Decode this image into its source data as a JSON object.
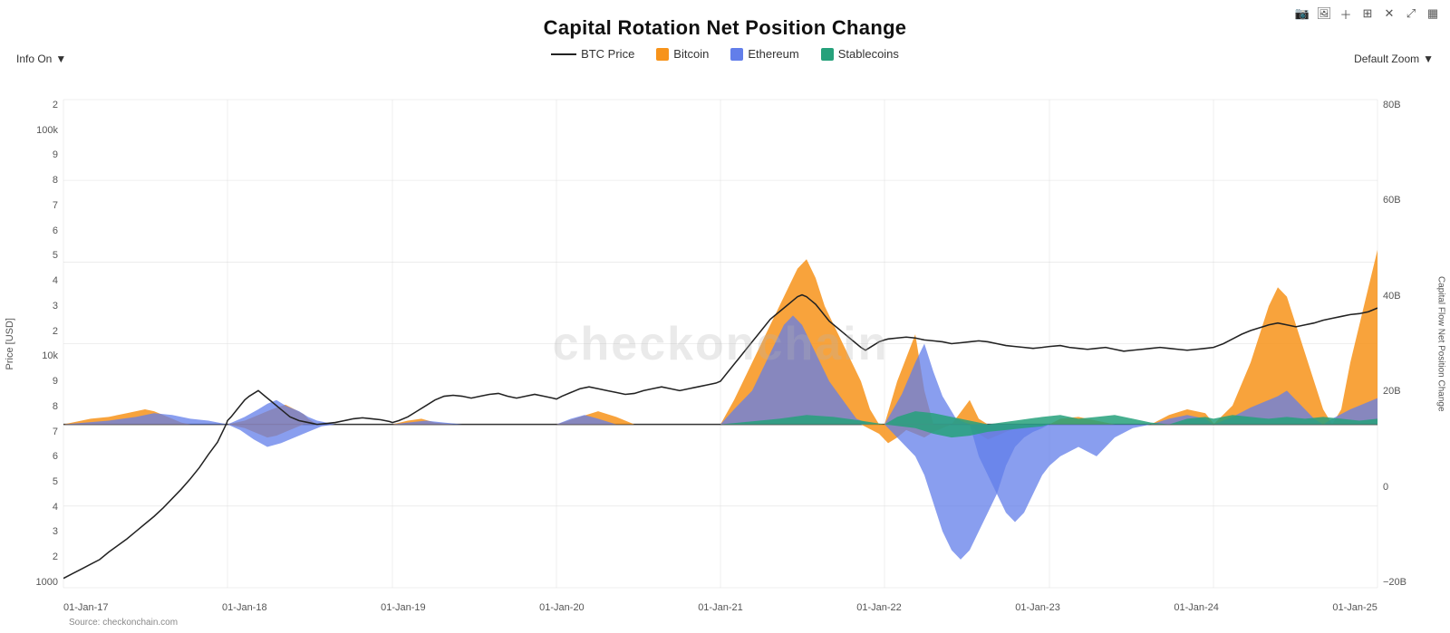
{
  "title": "Capital Rotation Net Position Change",
  "info_dropdown": {
    "label": "Info On",
    "value": "Info On"
  },
  "zoom_dropdown": {
    "label": "Default Zoom",
    "value": "Default Zoom"
  },
  "legend": {
    "items": [
      {
        "id": "btc-price",
        "label": "BTC Price",
        "type": "line",
        "color": "#222222"
      },
      {
        "id": "bitcoin",
        "label": "Bitcoin",
        "type": "area",
        "color": "#F7931A"
      },
      {
        "id": "ethereum",
        "label": "Ethereum",
        "type": "area",
        "color": "#627EEA"
      },
      {
        "id": "stablecoins",
        "label": "Stablecoins",
        "type": "area",
        "color": "#26A17B"
      }
    ]
  },
  "y_axis_left": {
    "label": "Price [USD]",
    "ticks": [
      "100k",
      "9",
      "8",
      "7",
      "6",
      "5",
      "4",
      "3",
      "2",
      "10k",
      "9",
      "8",
      "7",
      "6",
      "5",
      "4",
      "3",
      "2",
      "1000"
    ]
  },
  "y_axis_right": {
    "label": "Capital Flow Net Position Change",
    "ticks": [
      "80B",
      "60B",
      "40B",
      "20B",
      "0",
      "−20B"
    ]
  },
  "x_axis": {
    "ticks": [
      "01-Jan-17",
      "01-Jan-18",
      "01-Jan-19",
      "01-Jan-20",
      "01-Jan-21",
      "01-Jan-22",
      "01-Jan-23",
      "01-Jan-24",
      "01-Jan-25"
    ]
  },
  "watermark": "checkonchain",
  "source": "Source: checkonchain.com",
  "toolbar_icons": [
    "camera",
    "photo",
    "plus",
    "grid",
    "cross",
    "arrows",
    "chart"
  ]
}
